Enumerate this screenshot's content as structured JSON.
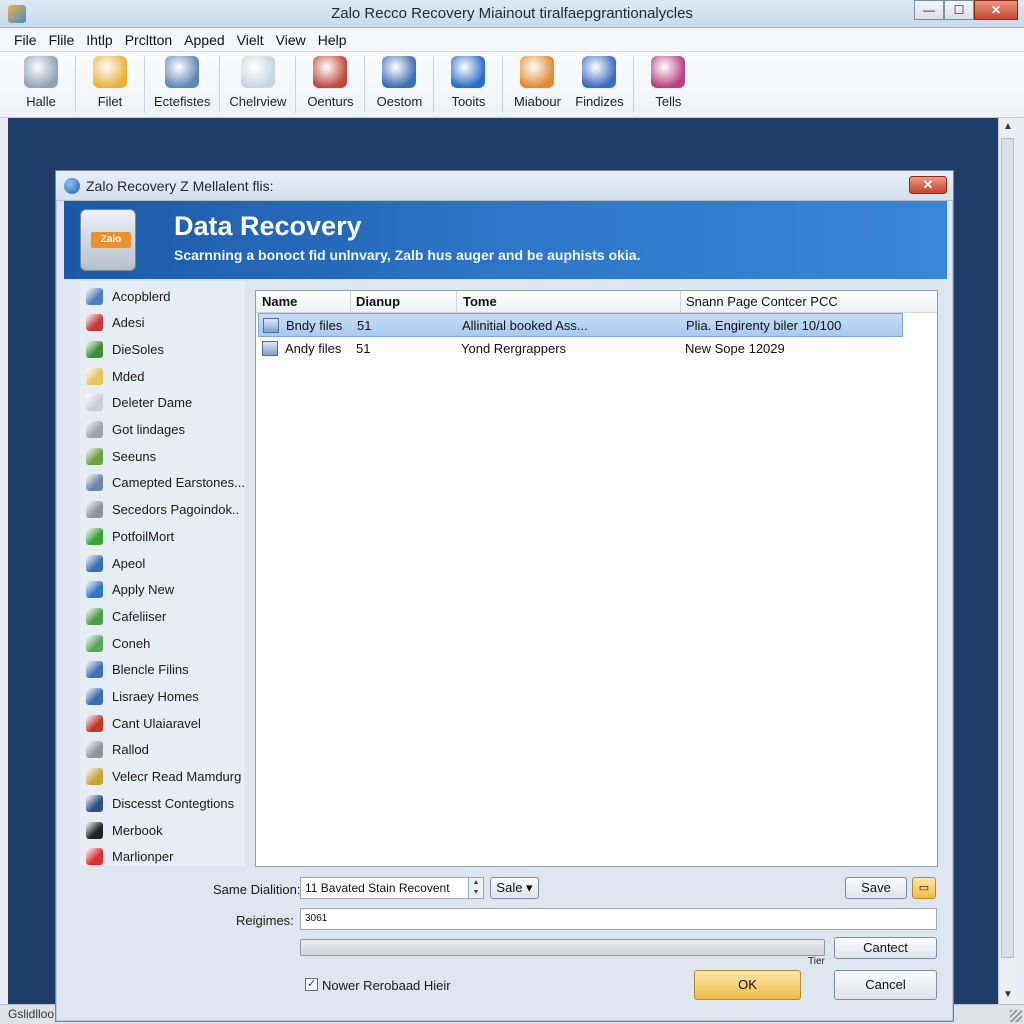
{
  "window": {
    "title": "Zalo Recco Recovery Miainout tiralfaepgrantionalycles",
    "statusbar_text": "Gslidlloo"
  },
  "menu": [
    "File",
    "Flile",
    "Ihtlp",
    "Prcltton",
    "Apped",
    "Vielt",
    "View",
    "Help"
  ],
  "toolbar": [
    {
      "label": "Halle",
      "icon": "lifebuoy-icon",
      "color": "#8fa3b8"
    },
    {
      "label": "Filet",
      "icon": "globe-icon",
      "color": "#e8b23a"
    },
    {
      "label": "Ectefistes",
      "icon": "user-network-icon",
      "color": "#5d87b8"
    },
    {
      "label": "Chelrview",
      "icon": "document-view-icon",
      "color": "#c9d5e4"
    },
    {
      "label": "Oenturs",
      "icon": "shopping-cart-icon",
      "color": "#c2493b"
    },
    {
      "label": "Oestom",
      "icon": "monitor-icon",
      "color": "#3b6fb3"
    },
    {
      "label": "Tooits",
      "icon": "info-globe-icon",
      "color": "#2a6ec7"
    },
    {
      "label": "Miabour",
      "icon": "flashlight-icon",
      "color": "#e2892f"
    },
    {
      "label": "Findizes",
      "icon": "recycle-icon",
      "color": "#3a6ac1"
    },
    {
      "label": "Tells",
      "icon": "tools-icon",
      "color": "#b8407e"
    }
  ],
  "dialog": {
    "title": "Zalo Recovery Z Mellalent flis:",
    "close_label": "✕",
    "banner_title": "Data Recovery",
    "banner_subtitle": "Scarnning a bonoct fid unlnvary, Zalb hus auger and be auphists okia.",
    "banner_badge": "Zalo"
  },
  "sidebar": [
    {
      "label": "Acopblerd",
      "icon": "monitor-icon",
      "color": "#4f7fbf"
    },
    {
      "label": "Adesi",
      "icon": "globe-icon",
      "color": "#c23a3a"
    },
    {
      "label": "DieSoles",
      "icon": "color-wheel-icon",
      "color": "#3b8f3b"
    },
    {
      "label": "Mded",
      "icon": "folder-icon",
      "color": "#e8c35a"
    },
    {
      "label": "Deleter Dame",
      "icon": "bulb-icon",
      "color": "#c9ced6"
    },
    {
      "label": "Got lindages",
      "icon": "arrow-icon",
      "color": "#9aa4b0"
    },
    {
      "label": "Seeuns",
      "icon": "image-icon",
      "color": "#6e9e45"
    },
    {
      "label": "Camepted Earstones...",
      "icon": "drive-icon",
      "color": "#6b86ad"
    },
    {
      "label": "Secedors Pagoindok..",
      "icon": "tools-icon",
      "color": "#8b94a1"
    },
    {
      "label": "PotfoilMort",
      "icon": "checkmark-icon",
      "color": "#3aa13a"
    },
    {
      "label": "Apeol",
      "icon": "person-icon",
      "color": "#3d6fb7"
    },
    {
      "label": "Apply New",
      "icon": "cross-icon",
      "color": "#2f75c8"
    },
    {
      "label": "Cafeliiser",
      "icon": "recycle-icon",
      "color": "#4a9e4a"
    },
    {
      "label": "Coneh",
      "icon": "leaf-icon",
      "color": "#5aa85a"
    },
    {
      "label": "Blencle Filins",
      "icon": "p-icon",
      "color": "#3e6fb7"
    },
    {
      "label": "Lisraey Homes",
      "icon": "person-icon",
      "color": "#3a6bb0"
    },
    {
      "label": "Cant Ulaiaravel",
      "icon": "face-icon",
      "color": "#c0392b"
    },
    {
      "label": "Rallod",
      "icon": "drive-icon",
      "color": "#8c96a3"
    },
    {
      "label": "Velecr Read Mamdurg",
      "icon": "image-icon",
      "color": "#c7a23a"
    },
    {
      "label": "Discesst Contegtions",
      "icon": "network-icon",
      "color": "#2f4f7f"
    },
    {
      "label": "Merbook",
      "icon": "book-icon",
      "color": "#222222"
    },
    {
      "label": "Marlionper",
      "icon": "play-icon",
      "color": "#d93030"
    }
  ],
  "filelist": {
    "columns": [
      "Name",
      "Dianup",
      "Tome",
      "Snann Page Contcer PCC"
    ],
    "rows": [
      {
        "name": "Bndy files",
        "dianup": "51",
        "tome": "Allinitial booked Ass...",
        "info": "Plia. Engirenty biler 10/100",
        "selected": true
      },
      {
        "name": "Andy files",
        "dianup": "51",
        "tome": "Yond Rergrappers",
        "info": "New Sope 12029",
        "selected": false
      }
    ]
  },
  "form": {
    "same_label": "Same Dialition:",
    "same_value": "11 Bavated Stain Recovent",
    "sale_label": "Sale ▾",
    "save_label": "Save",
    "regions_label": "Reigimes:",
    "regions_value": "3061",
    "contect_label": "Cantect",
    "progress_caption": "Tier",
    "progress_value": 0,
    "checkbox_label": "Nower Rerobaad Hieir",
    "checkbox_mark": "✓",
    "ok_label": "OK",
    "cancel_label": "Cancel"
  }
}
